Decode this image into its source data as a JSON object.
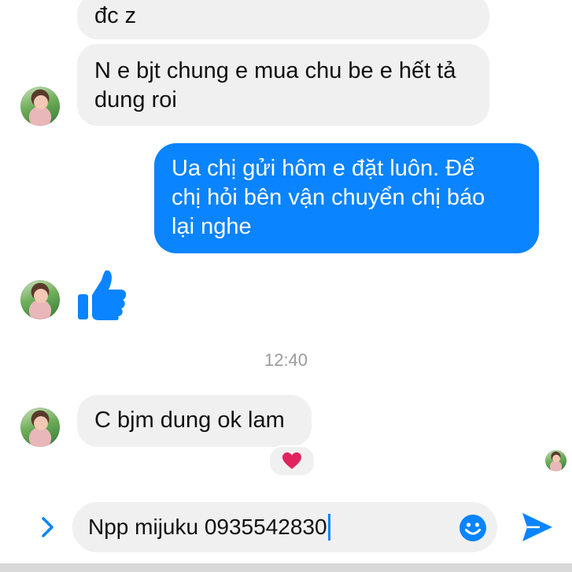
{
  "conversation": {
    "messages": [
      {
        "id": "m1",
        "direction": "incoming",
        "text": "đc z"
      },
      {
        "id": "m2",
        "direction": "incoming",
        "lines": [
          "N e bjt chung e mua chu be e hết tả",
          "dung roi"
        ]
      },
      {
        "id": "m3",
        "direction": "outgoing",
        "lines": [
          "Ua chị gửi hôm e đặt luôn. Để",
          "chị hỏi bên vận chuyển chị báo",
          "lại nghe"
        ]
      },
      {
        "id": "m4",
        "direction": "incoming",
        "type": "like-sticker",
        "icon": "thumbs-up-icon"
      },
      {
        "id": "m5",
        "direction": "incoming",
        "text": "C bjm dung ok lam",
        "reaction": "heart-icon"
      }
    ],
    "timestamp": "12:40"
  },
  "composer": {
    "value": "Npp mijuku 0935542830",
    "expand_icon": "chevron-right-icon",
    "emoji_icon": "smiley-icon",
    "send_icon": "send-icon"
  },
  "colors": {
    "accent": "#0a84ff",
    "incoming_bubble": "#f1f0f0",
    "reaction_heart": "#e0245e",
    "timestamp": "#9b9b9b"
  }
}
